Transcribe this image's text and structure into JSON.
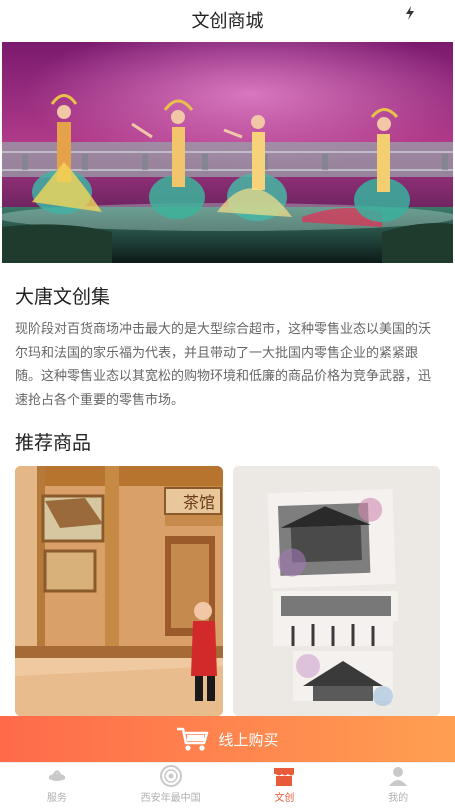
{
  "header": {
    "title": "文创商城",
    "status_icon": "flash-icon"
  },
  "hero": {
    "image": "dance-performance-stage"
  },
  "collection": {
    "title": "大唐文创集",
    "description": "现阶段对百货商场冲击最大的是大型综合超市，这种零售业态以美国的沃尔玛和法国的家乐福为代表，并且带动了一大批国内零售企业的紧紧跟随。这种零售业态以其宽松的购物环境和低廉的商品价格为竞争武器，迅速抢占各个重要的零售市场。"
  },
  "recommend": {
    "title": "推荐商品",
    "items": [
      {
        "image": "teahouse-illustration",
        "sign": "茶馆"
      },
      {
        "image": "xian-postcard-set"
      }
    ]
  },
  "buy_bar": {
    "label": "线上购买",
    "icon": "cart-icon"
  },
  "tabbar": {
    "tabs": [
      {
        "label": "服务",
        "icon": "service-icon"
      },
      {
        "label": "西安年最中国",
        "icon": "emblem-icon"
      },
      {
        "label": "文创",
        "icon": "shop-icon",
        "active": true
      },
      {
        "label": "我的",
        "icon": "user-icon"
      }
    ],
    "colors": {
      "active": "#e85b3a",
      "inactive": "#b0b0b0"
    }
  }
}
